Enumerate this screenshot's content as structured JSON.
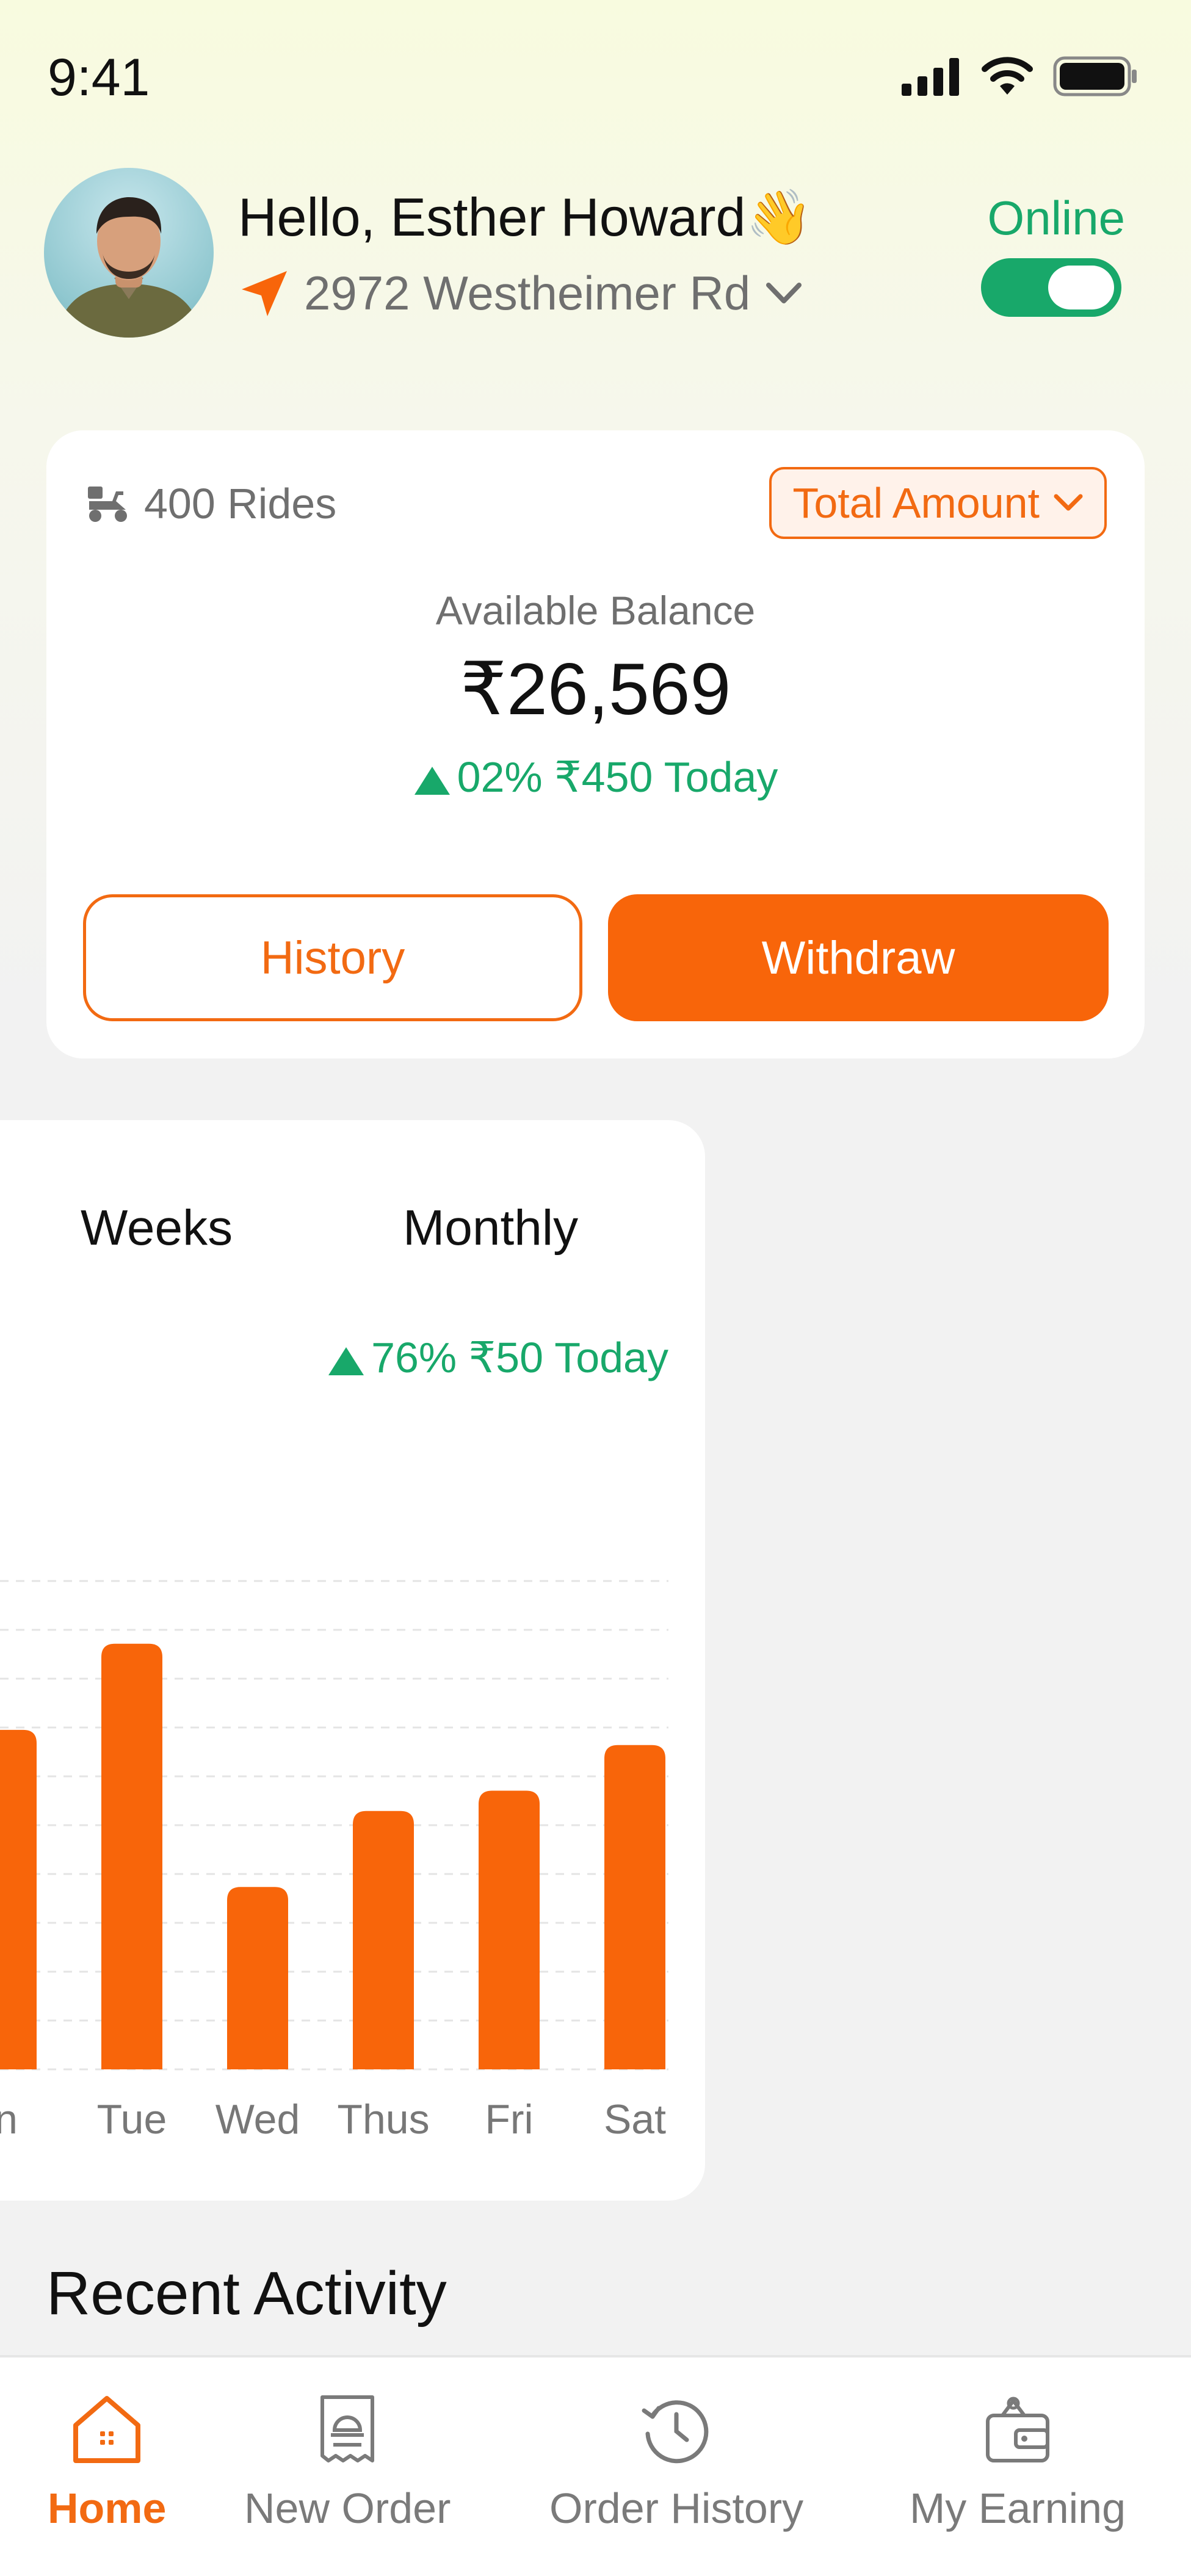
{
  "status_bar": {
    "time": "9:41"
  },
  "header": {
    "greeting": "Hello, Esther Howard👋",
    "location": "2972 Westheimer Rd",
    "online_label": "Online",
    "online": true
  },
  "balance_card": {
    "rides": "400 Rides",
    "amount_filter": "Total Amount",
    "available_label": "Available Balance",
    "balance": "₹26,569",
    "change": "02% ₹450 Today",
    "history_label": "History",
    "withdraw_label": "Withdraw"
  },
  "chart_card": {
    "tabs": [
      "Weeks",
      "Monthly"
    ],
    "change": "76% ₹50 Today"
  },
  "chart_data": {
    "type": "bar",
    "categories": [
      "n",
      "Tue",
      "Wed",
      "Thus",
      "Fri",
      "Sat"
    ],
    "values": [
      67,
      84,
      36,
      51,
      55,
      64
    ],
    "ylim": [
      0,
      100
    ],
    "grid": true,
    "bar_color": "#f8650a"
  },
  "recent_activity": {
    "title": "Recent Activity"
  },
  "bottom_nav": {
    "items": [
      {
        "label": "Home",
        "icon": "home-icon",
        "active": true
      },
      {
        "label": "New Order",
        "icon": "receipt-icon",
        "active": false
      },
      {
        "label": "Order History",
        "icon": "history-icon",
        "active": false
      },
      {
        "label": "My Earning",
        "icon": "wallet-icon",
        "active": false
      }
    ]
  },
  "colors": {
    "accent": "#f26a12",
    "success": "#18a86a",
    "text": "#111111",
    "muted": "#6f6f6f"
  }
}
